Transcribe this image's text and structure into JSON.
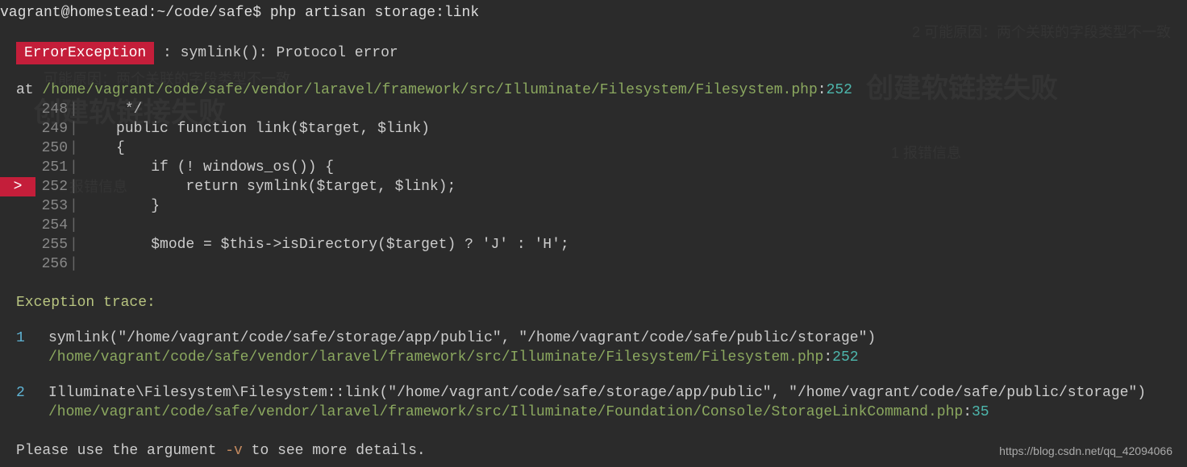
{
  "prompt": {
    "user_host": "vagrant@homestead:~/code/safe$",
    "command": "php artisan storage:link"
  },
  "error": {
    "badge": "ErrorException",
    "separator": " : ",
    "message": "symlink(): Protocol error"
  },
  "at": {
    "prefix": "at ",
    "path": "/home/vagrant/code/safe/vendor/laravel/framework/src/Illuminate/Filesystem/Filesystem.php",
    "sep": ":",
    "line": "252"
  },
  "code": {
    "lines": [
      {
        "num": "248",
        "text": "     */",
        "arrow": false
      },
      {
        "num": "249",
        "text": "    public function link($target, $link)",
        "arrow": false
      },
      {
        "num": "250",
        "text": "    {",
        "arrow": false
      },
      {
        "num": "251",
        "text": "        if (! windows_os()) {",
        "arrow": false
      },
      {
        "num": "252",
        "text": "            return symlink($target, $link);",
        "arrow": true
      },
      {
        "num": "253",
        "text": "        }",
        "arrow": false
      },
      {
        "num": "254",
        "text": "",
        "arrow": false
      },
      {
        "num": "255",
        "text": "        $mode = $this->isDirectory($target) ? 'J' : 'H';",
        "arrow": false
      },
      {
        "num": "256",
        "text": "",
        "arrow": false
      }
    ]
  },
  "trace": {
    "header": "Exception trace:",
    "items": [
      {
        "num": "1",
        "call": "symlink(\"/home/vagrant/code/safe/storage/app/public\", \"/home/vagrant/code/safe/public/storage\")",
        "path": "/home/vagrant/code/safe/vendor/laravel/framework/src/Illuminate/Filesystem/Filesystem.php",
        "sep": ":",
        "line": "252"
      },
      {
        "num": "2",
        "call": "Illuminate\\Filesystem\\Filesystem::link(\"/home/vagrant/code/safe/storage/app/public\", \"/home/vagrant/code/safe/public/storage\")",
        "path": "/home/vagrant/code/safe/vendor/laravel/framework/src/Illuminate/Foundation/Console/StorageLinkCommand.php",
        "sep": ":",
        "line": "35"
      }
    ]
  },
  "footer": {
    "prefix": "Please use the argument ",
    "arg": "-v",
    "suffix": " to see more details."
  },
  "watermark": "https://blog.csdn.net/qq_42094066",
  "ghost": {
    "g1": "2 可能原因：两个关联的字段类型不一致",
    "g2": "可能原因：两个关联的字段类型不一致",
    "g3": "创建软链接失败",
    "g4": "创建软链接失败",
    "g5": "1 报错信息",
    "g6": "报错信息"
  }
}
